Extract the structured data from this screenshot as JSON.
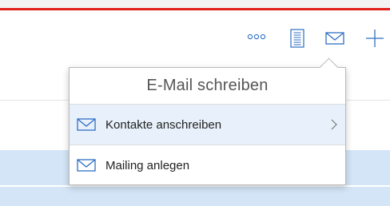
{
  "toolbar": {
    "items": [
      {
        "icon": "more-options-icon"
      },
      {
        "icon": "document-icon"
      },
      {
        "icon": "mail-icon"
      },
      {
        "icon": "plus-icon"
      }
    ]
  },
  "popover": {
    "title": "E-Mail schreiben",
    "items": [
      {
        "label": "Kontakte anschreiben",
        "icon": "mail-icon",
        "has_submenu": true,
        "highlighted": true
      },
      {
        "label": "Mailing anlegen",
        "icon": "mail-icon",
        "has_submenu": false,
        "highlighted": false
      }
    ]
  },
  "colors": {
    "accent_red": "#e1201b",
    "icon_blue": "#2f6fc3",
    "row_highlight": "#d3e5f7",
    "menu_highlight": "#e8f1fb"
  }
}
